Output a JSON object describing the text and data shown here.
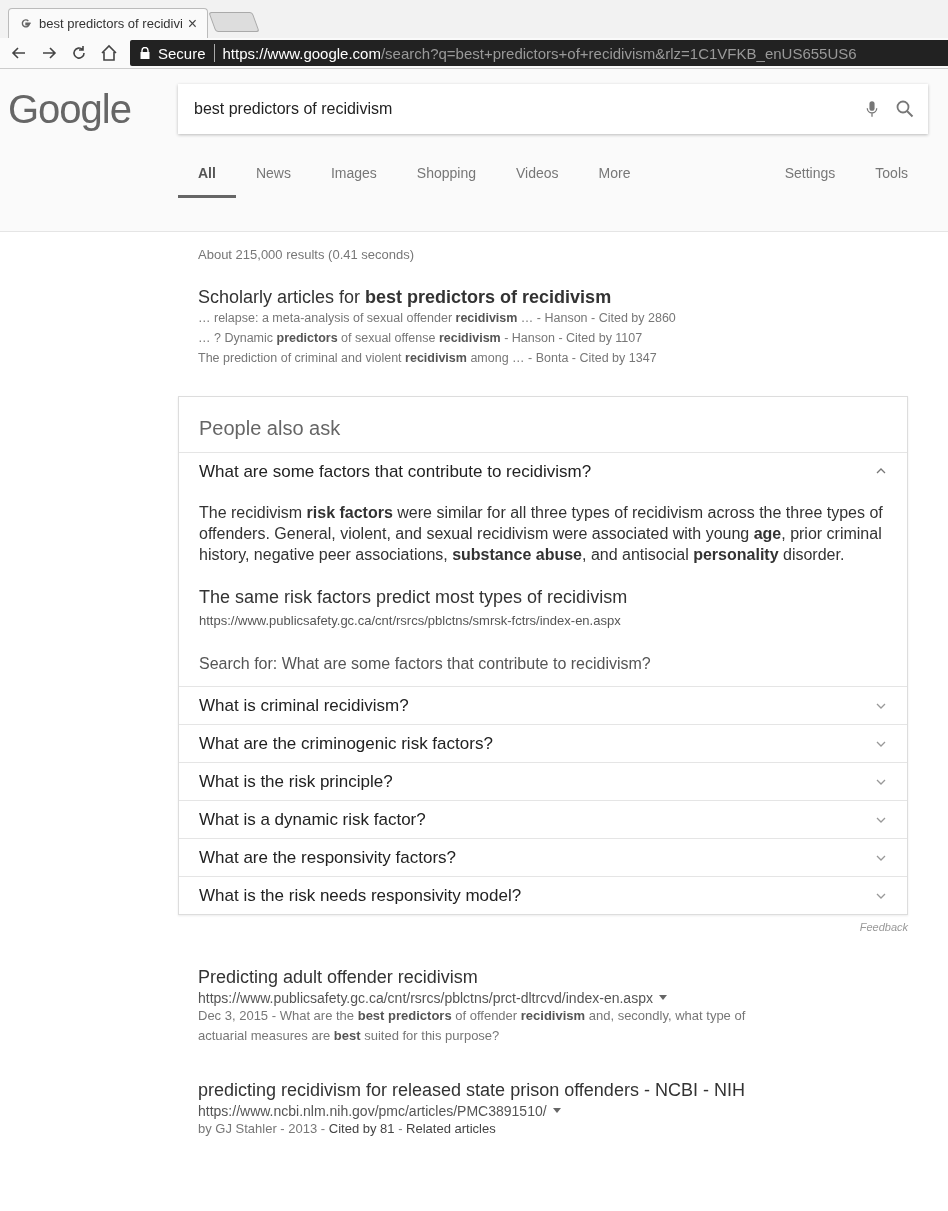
{
  "browser": {
    "tab": {
      "title": "best predictors of recidivi",
      "close": "×",
      "selected": true
    },
    "address": {
      "security": "Secure",
      "url_host": "https://www.google.com",
      "url_path": "/search?q=best+predictors+of+recidivism&rlz=1C1VFKB_enUS655US6"
    }
  },
  "logo": "Google",
  "search": {
    "value": "best predictors of recidivism"
  },
  "nav": {
    "tabs": [
      {
        "label": "All",
        "selected": true
      },
      {
        "label": "News",
        "selected": false
      },
      {
        "label": "Images",
        "selected": false
      },
      {
        "label": "Shopping",
        "selected": false
      },
      {
        "label": "Videos",
        "selected": false
      },
      {
        "label": "More",
        "selected": false
      }
    ],
    "right": [
      "Settings",
      "Tools"
    ]
  },
  "result_stats": "About 215,000 results (0.41 seconds)",
  "scholarly": {
    "title": "Scholarly articles for **best predictors of recidivism**",
    "lines": [
      "… relapse: a meta-analysis of sexual offender **recidivism** … - Hanson - Cited by 2860",
      "… ? Dynamic **predictors** of sexual offense **recidivism** - Hanson - Cited by 1107",
      "The prediction of criminal and violent **recidivism** among … - Bonta - Cited by 1347"
    ]
  },
  "people_also_ask": {
    "title": "People also ask",
    "questions": [
      {
        "text": "What are some factors that contribute to recidivism?",
        "expanded": true,
        "answer": "The recidivism **risk factors** were similar for all three types of recidivism across the three types of offenders. General, violent, and sexual recidivism were associated with young **age**, prior criminal history, negative peer associations, **substance abuse**, and antisocial **personality** disorder.",
        "source_title": "The same risk factors predict most types of recidivism",
        "source_url": "https://www.publicsafety.gc.ca/cnt/rsrcs/pblctns/smrsk-fctrs/index-en.aspx",
        "search_for": "Search for: What are some factors that contribute to recidivism?"
      },
      {
        "text": "What is criminal recidivism?",
        "expanded": false
      },
      {
        "text": "What are the criminogenic risk factors?",
        "expanded": false
      },
      {
        "text": "What is the risk principle?",
        "expanded": false
      },
      {
        "text": "What is a dynamic risk factor?",
        "expanded": false
      },
      {
        "text": "What are the responsivity factors?",
        "expanded": false
      },
      {
        "text": "What is the risk needs responsivity model?",
        "expanded": false
      }
    ],
    "feedback": "Feedback"
  },
  "results": [
    {
      "title": "Predicting adult offender recidivism",
      "url": "https://www.publicsafety.gc.ca/cnt/rsrcs/pblctns/prct-dltrcvd/index-en.aspx",
      "snippet": [
        {
          "kind": "text",
          "text": "Dec 3, 2015 - What are the **best predictors** of offender **recidivism** and, secondly, what type of actuarial measures are **best** suited for this purpose?"
        }
      ]
    },
    {
      "title": "predicting recidivism for released state prison offenders - NCBI - NIH",
      "url": "https://www.ncbi.nlm.nih.gov/pmc/articles/PMC3891510/",
      "snippet": [
        {
          "kind": "text",
          "text": "by GJ Stahler - 2013 - "
        },
        {
          "kind": "link",
          "text": "Cited by 81"
        },
        {
          "kind": "text",
          "text": " - "
        },
        {
          "kind": "link",
          "text": "Related articles"
        }
      ]
    }
  ]
}
